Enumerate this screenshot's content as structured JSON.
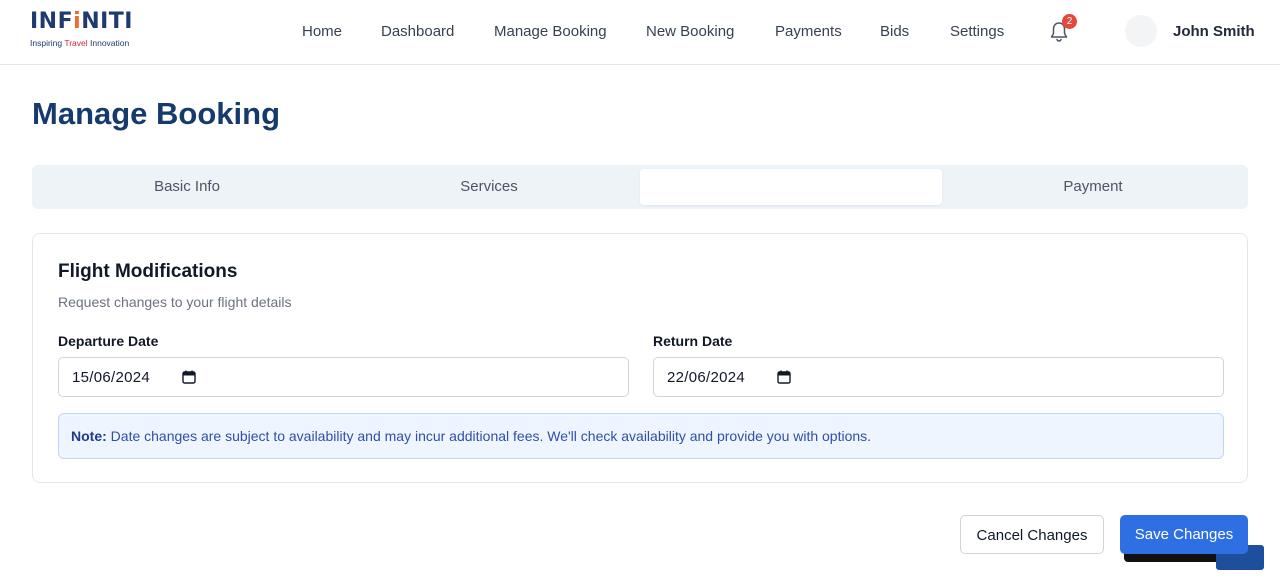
{
  "brand": {
    "name_part1": "INF",
    "name_dot": "i",
    "name_part2": "NITI",
    "tagline_part1": "Inspiring ",
    "tagline_accent": "Travel",
    "tagline_part2": " Innovation"
  },
  "nav": {
    "items": [
      "Home",
      "Dashboard",
      "Manage Booking",
      "New Booking",
      "Payments",
      "Bids",
      "Settings"
    ],
    "notification_count": "2",
    "user_name": "John Smith"
  },
  "page": {
    "title": "Manage Booking"
  },
  "tabs": [
    {
      "label": "Basic Info"
    },
    {
      "label": "Services"
    },
    {
      "label": ""
    },
    {
      "label": "Payment"
    }
  ],
  "flight": {
    "title": "Flight Modifications",
    "subtitle": "Request changes to your flight details",
    "departure_label": "Departure Date",
    "departure_value": "15/06/2024",
    "return_label": "Return Date",
    "return_value": "22/06/2024",
    "note_label": "Note:",
    "note_text": " Date changes are subject to availability and may incur additional fees. We'll check availability and provide you with options."
  },
  "actions": {
    "cancel_label": "Cancel Changes",
    "save_label": "Save Changes"
  },
  "colors": {
    "primary": "#2f6fe4",
    "title": "#163a6b",
    "badge": "#e5483a",
    "note_bg": "#eef5ff"
  },
  "icons": [
    "bell-icon",
    "calendar-icon"
  ]
}
